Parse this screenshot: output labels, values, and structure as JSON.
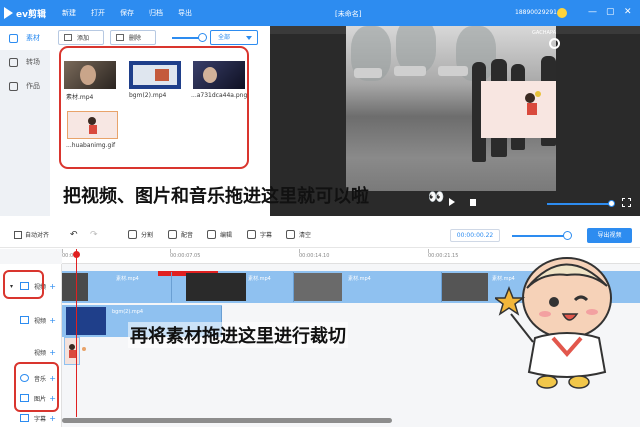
{
  "app": {
    "logo_text": "ev剪辑",
    "menu": [
      "新建",
      "打开",
      "保存",
      "归档",
      "导出"
    ],
    "doc_title": "[未命名]",
    "user_phone": "18890029291",
    "window_buttons": [
      "minimize-icon",
      "restore-icon",
      "close-icon"
    ]
  },
  "sidebar": {
    "tabs": [
      {
        "label": "素材",
        "icon": "grid-icon",
        "active": true
      },
      {
        "label": "转场",
        "icon": "transition-icon",
        "active": false
      },
      {
        "label": "作品",
        "icon": "folder-icon",
        "active": false
      }
    ]
  },
  "media_panel": {
    "add_label": "添加",
    "delete_label": "删除",
    "filter_value": "全部",
    "items": [
      {
        "label": "素材.mp4"
      },
      {
        "label": "bgm(2).mp4"
      },
      {
        "label": "...a731dca44a.png"
      },
      {
        "label": "...huabanimg.gif"
      }
    ]
  },
  "preview": {
    "watermark": "GACHAPA",
    "caption": "把视频、图片和音乐拖进这里就可以啦"
  },
  "edit_toolbar": {
    "auto_snap": "自动对齐",
    "split": "分割",
    "dub": "配音",
    "edit": "编辑",
    "subtitle": "字幕",
    "clear": "清空",
    "timecode": "00:00:00.22",
    "export": "导出视频"
  },
  "timeline": {
    "ruler": [
      "00:00",
      "00:00:07.05",
      "00:00:14.10",
      "00:00:21.15"
    ],
    "tracks": [
      {
        "label": "视频",
        "plus": "+"
      },
      {
        "label": "视频",
        "plus": "+"
      },
      {
        "label": "视频",
        "plus": "+"
      },
      {
        "label": "音乐",
        "plus": "+"
      },
      {
        "label": "图片",
        "plus": "+"
      },
      {
        "label": "字幕",
        "plus": "+"
      }
    ],
    "clip_labels": [
      "素材.mp4",
      "素材.mp4",
      "素材.mp4",
      "素材.mp4"
    ],
    "bgm_clip_label": "bgm(2).mp4",
    "caption": "再将素材拖进这里进行裁切"
  },
  "colors": {
    "brand": "#2d8cf0",
    "annotation_red": "#d9352e",
    "track_blue": "#8fc1f0"
  }
}
